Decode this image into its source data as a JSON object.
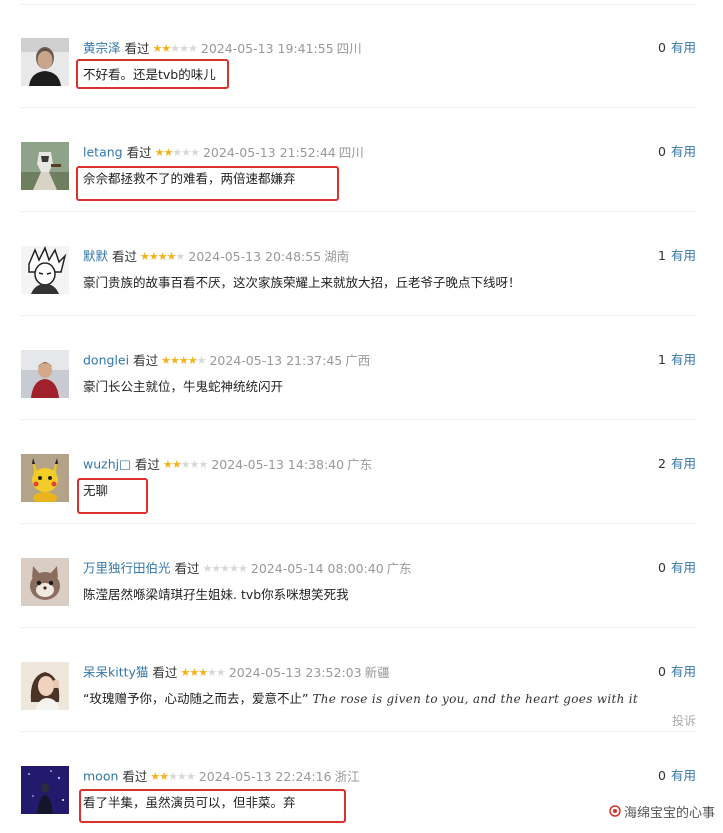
{
  "action_label": "看过",
  "vote_label": "有用",
  "report_label": "投诉",
  "colors": {
    "user_link": "#3377aa",
    "star_on": "#f5b21b",
    "star_off": "#d8d8d8",
    "highlight": "#d9322a"
  },
  "comments": [
    {
      "user": "黄宗泽",
      "rating": 2,
      "time": "2024-05-13 19:41:55",
      "region": "四川",
      "votes": "0",
      "content": "不好看。还是tvb的味儿",
      "highlighted": true,
      "avatar": "portrait-man"
    },
    {
      "user": "letang",
      "rating": 2,
      "time": "2024-05-13 21:52:44",
      "region": "四川",
      "votes": "0",
      "content": "佘佘都拯救不了的难看，两倍速都嫌弃",
      "highlighted": true,
      "avatar": "game-character"
    },
    {
      "user": "默默",
      "rating": 4,
      "time": "2024-05-13 20:48:55",
      "region": "湖南",
      "votes": "1",
      "content": "豪门贵族的故事百看不厌，这次家族荣耀上来就放大招，丘老爷子晚点下线呀！",
      "highlighted": false,
      "avatar": "anime-white-hair"
    },
    {
      "user": "donglei",
      "rating": 4,
      "time": "2024-05-13 21:37:45",
      "region": "广西",
      "votes": "1",
      "content": "豪门长公主就位，牛鬼蛇神统统闪开",
      "highlighted": false,
      "avatar": "portrait-red-coat"
    },
    {
      "user": "wuzhj□",
      "rating": 2,
      "time": "2024-05-13 14:38:40",
      "region": "广东",
      "votes": "2",
      "content": "无聊",
      "highlighted": true,
      "avatar": "pikachu"
    },
    {
      "user": "万里独行田伯光",
      "rating": 0,
      "time": "2024-05-14 08:00:40",
      "region": "广东",
      "votes": "0",
      "content": "陈滢居然喺梁靖琪孖生姐妹. tvb你系咪想笑死我",
      "highlighted": false,
      "avatar": "cat-toy"
    },
    {
      "user": "呆呆kitty猫",
      "rating": 3,
      "time": "2024-05-13 23:52:03",
      "region": "新疆",
      "votes": "0",
      "content": "“玫瑰赠予你，心动随之而去，爱意不止”",
      "content_en": "The rose is given to you, and the heart goes with it",
      "show_report": true,
      "highlighted": false,
      "avatar": "portrait-woman"
    },
    {
      "user": "moon",
      "rating": 2,
      "time": "2024-05-13 22:24:16",
      "region": "浙江",
      "votes": "0",
      "content": "看了半集，虽然演员可以，但非菜。弃",
      "highlighted": true,
      "avatar": "night-figure"
    }
  ],
  "watermark": "海绵宝宝的心事"
}
